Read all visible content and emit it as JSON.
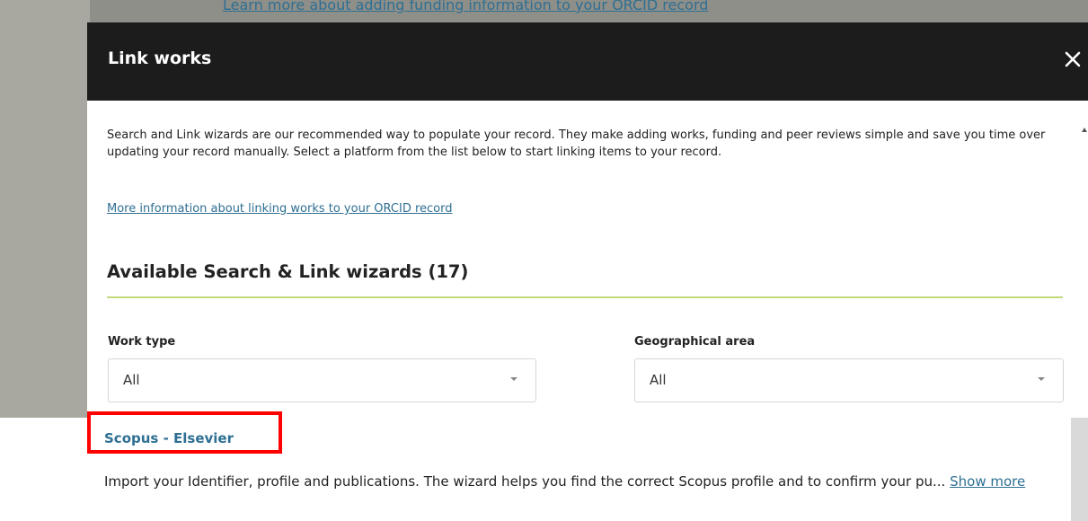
{
  "background": {
    "link_text": "Learn more about adding funding information to your ORCID record"
  },
  "modal": {
    "title": "Link works",
    "close_icon": "close-icon",
    "intro": "Search and Link wizards are our recommended way to populate your record. They make adding works, funding and peer reviews simple and save you time over updating your record manually. Select a platform from the list below to start linking items to your record.",
    "more_info_link": "More information about linking works to your ORCID record",
    "section_title": "Available Search & Link wizards (17)",
    "filters": {
      "work_type": {
        "label": "Work type",
        "value": "All"
      },
      "geographical_area": {
        "label": "Geographical area",
        "value": "All"
      }
    }
  },
  "wizards": [
    {
      "name": "Scopus - Elsevier",
      "description": "Import your Identifier, profile and publications. The wizard helps you find the correct Scopus profile and to confirm your pu...",
      "show_more": "Show more"
    }
  ],
  "colors": {
    "header_bg": "#1c1c1c",
    "link": "#2e6f93",
    "section_rule": "#c2d97c",
    "highlight": "#ff0000"
  }
}
